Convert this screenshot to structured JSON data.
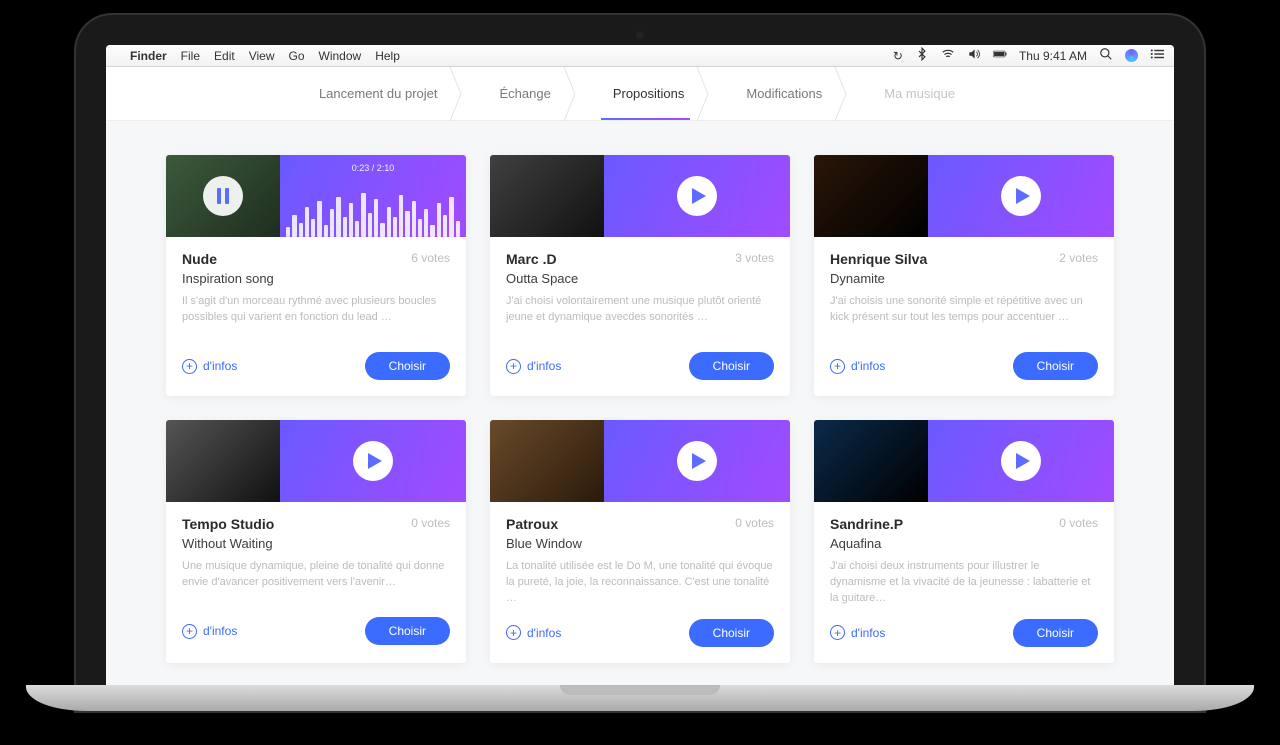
{
  "menubar": {
    "app": "Finder",
    "items": [
      "File",
      "Edit",
      "View",
      "Go",
      "Window",
      "Help"
    ],
    "time": "Thu 9:41 AM"
  },
  "breadcrumbs": {
    "items": [
      {
        "label": "Lancement du projet",
        "state": "default"
      },
      {
        "label": "Échange",
        "state": "default"
      },
      {
        "label": "Propositions",
        "state": "active"
      },
      {
        "label": "Modifications",
        "state": "default"
      },
      {
        "label": "Ma musique",
        "state": "disabled"
      }
    ]
  },
  "labels": {
    "info": "d'infos",
    "choose": "Choisir"
  },
  "cards": [
    {
      "artist": "Nude",
      "track": "Inspiration song",
      "votes": "6 votes",
      "desc": "Il s'agit d'un morceau rythmé avec plusieurs boucles possibles qui varient en fonction du lead …",
      "playing": true,
      "timecode": "0:23 / 2:10",
      "thumb": "t1"
    },
    {
      "artist": "Marc .D",
      "track": "Outta Space",
      "votes": "3 votes",
      "desc": "J'ai choisi volontairement une musique plutôt orienté jeune et dynamique avecdes sonorités …",
      "playing": false,
      "thumb": "t2"
    },
    {
      "artist": "Henrique Silva",
      "track": "Dynamite",
      "votes": "2 votes",
      "desc": "J'ai choisis une sonorité simple et répétitive avec un kick présent sur tout les temps pour accentuer …",
      "playing": false,
      "thumb": "t3"
    },
    {
      "artist": "Tempo Studio",
      "track": "Without Waiting",
      "votes": "0 votes",
      "desc": "Une musique dynamique, pleine de tonalité qui donne envie d'avancer positivement vers l'avenir…",
      "playing": false,
      "thumb": "t4"
    },
    {
      "artist": "Patroux",
      "track": "Blue Window",
      "votes": "0 votes",
      "desc": "La tonalité utilisée est le Do M, une tonalité qui évoque la pureté, la joie, la reconnaissance. C'est une tonalité …",
      "playing": false,
      "thumb": "t5"
    },
    {
      "artist": "Sandrine.P",
      "track": "Aquafina",
      "votes": "0 votes",
      "desc": "J'ai choisi deux instruments pour illustrer le dynamisme et la vivacité de la jeunesse : labatterie et la guitare…",
      "playing": false,
      "thumb": "t6"
    }
  ],
  "waveform_heights": [
    10,
    22,
    14,
    30,
    18,
    36,
    12,
    28,
    40,
    20,
    34,
    16,
    44,
    24,
    38,
    14,
    30,
    20,
    42,
    26,
    36,
    18,
    28,
    12,
    34,
    22,
    40,
    16
  ]
}
